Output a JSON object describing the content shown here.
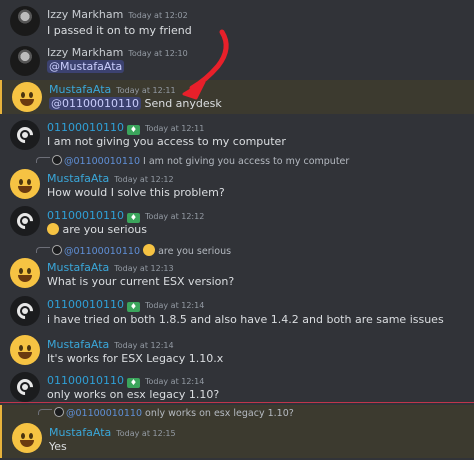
{
  "messages": [
    {
      "author": "Izzy Markham",
      "time": "Today at 12:02",
      "text": "I passed it on to my friend"
    },
    {
      "author": "Izzy Markham",
      "time": "Today at 12:10",
      "mention": "@MustafaAta"
    },
    {
      "author": "MustafaAta",
      "time": "Today at 12:11",
      "mention": "@01100010110",
      "text": "Send anydesk"
    },
    {
      "author": "01100010110",
      "time": "Today at 12:11",
      "text": "I am not giving you access to my computer"
    },
    {
      "reply_to": "@01100010110",
      "reply_text": "I am not giving you access to my computer",
      "author": "MustafaAta",
      "time": "Today at 12:12",
      "text": "How would I solve this problem?"
    },
    {
      "author": "01100010110",
      "time": "Today at 12:12",
      "text": "are you serious"
    },
    {
      "reply_to": "@01100010110",
      "reply_text": "are you serious",
      "author": "MustafaAta",
      "time": "Today at 12:13",
      "text": "What is your current ESX version?"
    },
    {
      "author": "01100010110",
      "time": "Today at 12:14",
      "text": "i have tried on both 1.8.5 and also have 1.4.2 and both are same issues"
    },
    {
      "author": "MustafaAta",
      "time": "Today at 12:14",
      "text": "It's works for ESX Legacy 1.10.x"
    },
    {
      "author": "01100010110",
      "time": "Today at 12:14",
      "text": "only works on esx legacy 1.10?"
    },
    {
      "reply_to": "@01100010110",
      "reply_text": "only works on esx legacy 1.10?",
      "author": "MustafaAta",
      "time": "Today at 12:15",
      "text": "Yes"
    }
  ],
  "colors": {
    "background": "#313338",
    "highlight": "#3c3a2f",
    "arrow": "#e8202a",
    "divider": "#c0354b"
  },
  "icons": {
    "badge": "role-badge-icon",
    "arrow": "red-arrow-annotation"
  }
}
